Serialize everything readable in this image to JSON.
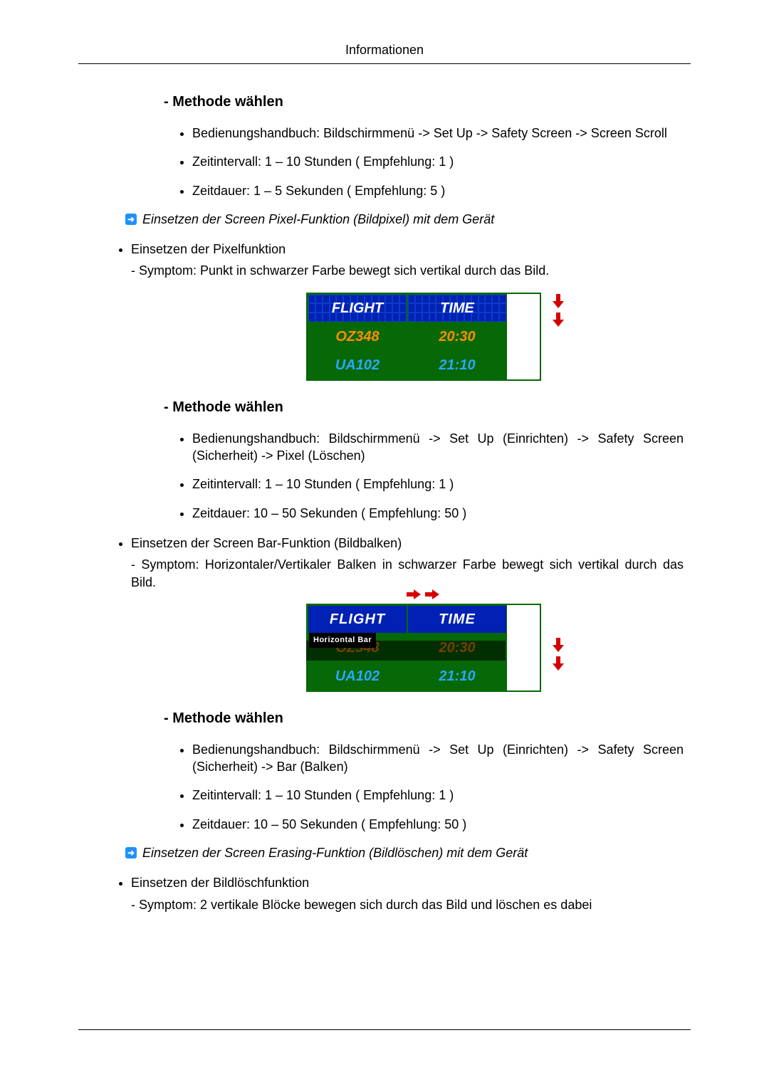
{
  "header": {
    "title": "Informationen"
  },
  "sections": {
    "s1": {
      "heading": "- Methode wählen",
      "items": [
        "Bedienungshandbuch: Bildschirmmenü -> Set Up -> Safety Screen -> Screen Scroll",
        "Zeitintervall: 1 – 10 Stunden ( Empfehlung: 1 )",
        "Zeitdauer: 1 – 5 Sekunden ( Empfehlung: 5 )"
      ]
    },
    "noteA": "Einsetzen der Screen Pixel-Funktion (Bildpixel) mit dem Gerät",
    "pixelFn": {
      "title": "Einsetzen der Pixelfunktion",
      "symptom": "- Symptom: Punkt in schwarzer Farbe bewegt sich vertikal durch das Bild."
    },
    "s2": {
      "heading": "- Methode wählen",
      "items": [
        "Bedienungshandbuch: Bildschirmmenü -> Set Up (Einrichten) -> Safety Screen (Sicherheit) -> Pixel (Löschen)",
        "Zeitintervall: 1 – 10 Stunden ( Empfehlung: 1 )",
        "Zeitdauer: 10 – 50 Sekunden ( Empfehlung: 50 )"
      ]
    },
    "barFn": {
      "title": "Einsetzen der Screen Bar-Funktion (Bildbalken)",
      "symptom": "- Symptom: Horizontaler/Vertikaler Balken in schwarzer Farbe bewegt sich vertikal durch das Bild."
    },
    "s3": {
      "heading": "- Methode wählen",
      "items": [
        "Bedienungshandbuch: Bildschirmmenü -> Set Up (Einrichten) -> Safety Screen (Sicherheit) -> Bar (Balken)",
        "Zeitintervall: 1 – 10 Stunden ( Empfehlung: 1 )",
        "Zeitdauer: 10 – 50 Sekunden ( Empfehlung: 50 )"
      ]
    },
    "noteB": "Einsetzen der Screen Erasing-Funktion (Bildlöschen) mit dem Gerät",
    "eraseFn": {
      "title": "Einsetzen der Bildlöschfunktion",
      "symptom": "- Symptom: 2 vertikale Blöcke bewegen sich durch das Bild und löschen es dabei"
    }
  },
  "board": {
    "headers": [
      "FLIGHT",
      "TIME"
    ],
    "rows": [
      {
        "flight": "OZ348",
        "time": "20:30"
      },
      {
        "flight": "UA102",
        "time": "21:10"
      }
    ],
    "hbar_label": "Horizontal Bar"
  },
  "chart_data": [
    {
      "type": "table",
      "title": "Flight board (pixel function illustration)",
      "columns": [
        "FLIGHT",
        "TIME"
      ],
      "rows": [
        [
          "OZ348",
          "20:30"
        ],
        [
          "UA102",
          "21:10"
        ]
      ],
      "annotations": [
        "down-arrows-right-side"
      ]
    },
    {
      "type": "table",
      "title": "Flight board (bar function illustration)",
      "columns": [
        "FLIGHT",
        "TIME"
      ],
      "rows": [
        [
          "OZ348",
          "20:30"
        ],
        [
          "UA102",
          "21:10"
        ]
      ],
      "annotations": [
        "right-arrows-top",
        "down-arrows-right-side",
        "Horizontal Bar overlay"
      ]
    }
  ]
}
